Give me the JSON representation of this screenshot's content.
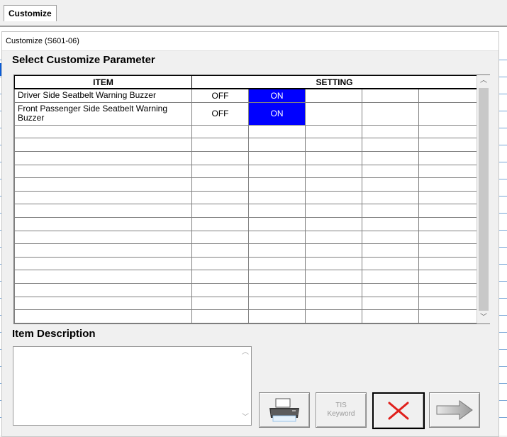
{
  "app": {
    "tab_label": "Customize"
  },
  "dialog": {
    "title": "Customize (S601-06)",
    "section_select": "Select Customize Parameter",
    "section_description": "Item Description"
  },
  "grid": {
    "headers": {
      "item": "ITEM",
      "setting": "SETTING"
    },
    "rows": [
      {
        "item": "Driver Side Seatbelt Warning Buzzer",
        "off": "OFF",
        "on": "ON",
        "selected": "ON"
      },
      {
        "item": "Front Passenger Side Seatbelt Warning Buzzer",
        "off": "OFF",
        "on": "ON",
        "selected": "ON"
      }
    ],
    "empty_rows": 15
  },
  "item_description": "",
  "buttons": {
    "print": "print-icon",
    "tis_keyword_line1": "TIS",
    "tis_keyword_line2": "Keyword",
    "close": "close-icon",
    "next": "arrow-right-icon"
  },
  "colors": {
    "selection": "#0000ff",
    "close_x": "#e0201c"
  }
}
